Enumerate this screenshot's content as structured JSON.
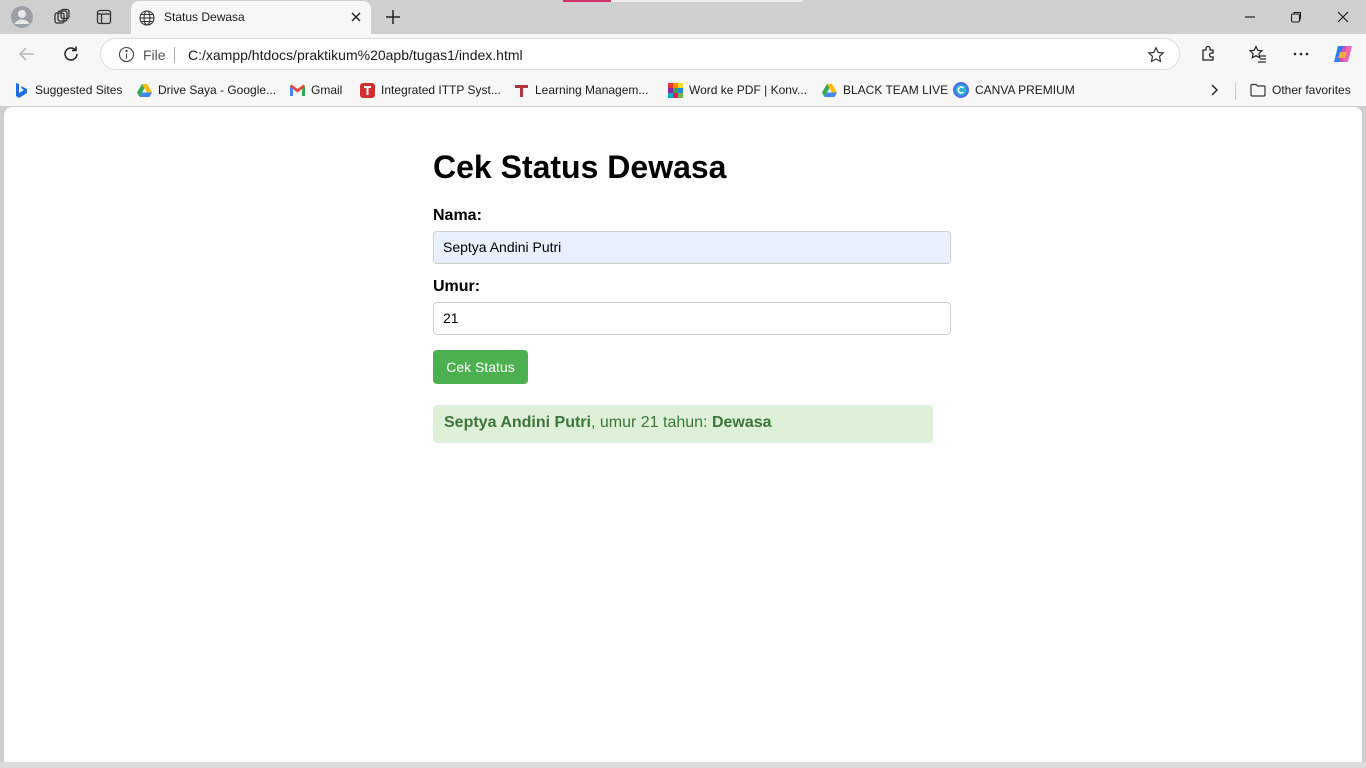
{
  "tab": {
    "title": "Status Dewasa"
  },
  "address_bar": {
    "scheme_label": "File",
    "url": "C:/xampp/htdocs/praktikum%20apb/tugas1/index.html"
  },
  "bookmarks": [
    {
      "label": "Suggested Sites",
      "icon": "bing-icon"
    },
    {
      "label": "Drive Saya - Google...",
      "icon": "google-drive-icon"
    },
    {
      "label": "Gmail",
      "icon": "gmail-icon"
    },
    {
      "label": "Integrated ITTP Syst...",
      "icon": "ittp-icon"
    },
    {
      "label": "Learning Managem...",
      "icon": "lms-icon"
    },
    {
      "label": "Word ke PDF | Konv...",
      "icon": "word-pdf-icon"
    },
    {
      "label": "BLACK TEAM LIVE",
      "icon": "google-drive-icon"
    },
    {
      "label": "CANVA PREMIUM",
      "icon": "canva-icon"
    }
  ],
  "other_favorites": "Other favorites",
  "page": {
    "heading": "Cek Status Dewasa",
    "name_label": "Nama:",
    "name_value": "Septya Andini Putri",
    "age_label": "Umur:",
    "age_value": "21",
    "button_label": "Cek Status",
    "result": {
      "name": "Septya Andini Putri",
      "middle": ", umur 21 tahun: ",
      "status": "Dewasa"
    }
  },
  "colors": {
    "button": "#4caf50",
    "result_bg": "#dff0d8",
    "result_text": "#3c763d",
    "autofill_bg": "#e8f0fe"
  }
}
